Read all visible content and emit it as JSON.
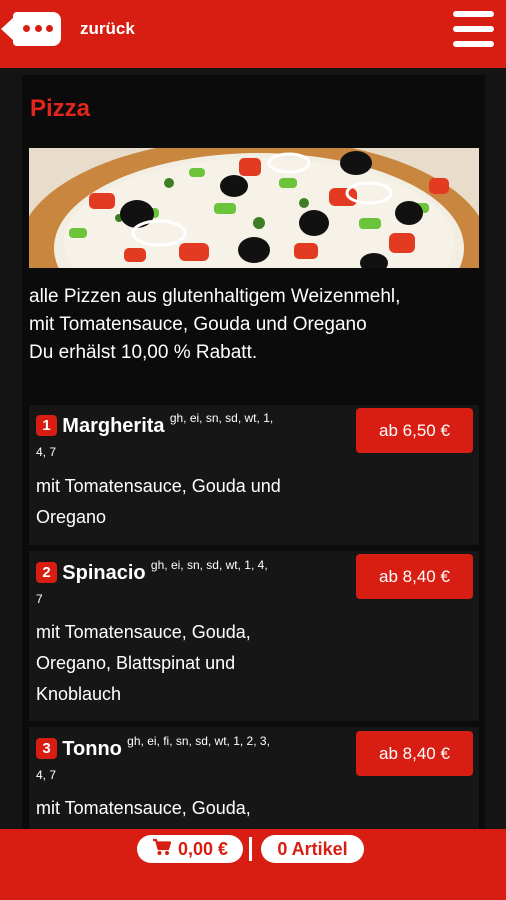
{
  "header": {
    "back_label": "zurück"
  },
  "category": {
    "title": "Pizza",
    "description_lines": [
      "alle Pizzen aus glutenhaltigem Weizenmehl,",
      "mit Tomatensauce, Gouda und Oregano",
      "Du erhälst 10,00 % Rabatt."
    ]
  },
  "items": [
    {
      "number": "1",
      "name": "Margherita",
      "allergens_line1": "gh, ei, sn, sd, wt, 1,",
      "allergens_line2": "4, 7",
      "desc_lines": [
        "mit Tomatensauce, Gouda und",
        "Oregano"
      ],
      "price": "ab 6,50 €"
    },
    {
      "number": "2",
      "name": "Spinacio",
      "allergens_line1": "gh, ei, sn, sd, wt, 1, 4,",
      "allergens_line2": "7",
      "desc_lines": [
        "mit Tomatensauce, Gouda,",
        "Oregano, Blattspinat und",
        "Knoblauch"
      ],
      "price": "ab 8,40 €"
    },
    {
      "number": "3",
      "name": "Tonno",
      "allergens_line1": "gh, ei, fi, sn, sd, wt, 1, 2, 3,",
      "allergens_line2": "4, 7",
      "desc_lines": [
        "mit Tomatensauce, Gouda,"
      ],
      "price": "ab 8,40 €"
    }
  ],
  "footer": {
    "cart_total": "0,00 €",
    "cart_count": "0 Artikel"
  },
  "colors": {
    "brand_red": "#d81e12",
    "title_red": "#e3261b",
    "background": "#0b0b0b"
  },
  "icons": [
    "back-icon",
    "hamburger-menu-icon",
    "cart-icon"
  ]
}
